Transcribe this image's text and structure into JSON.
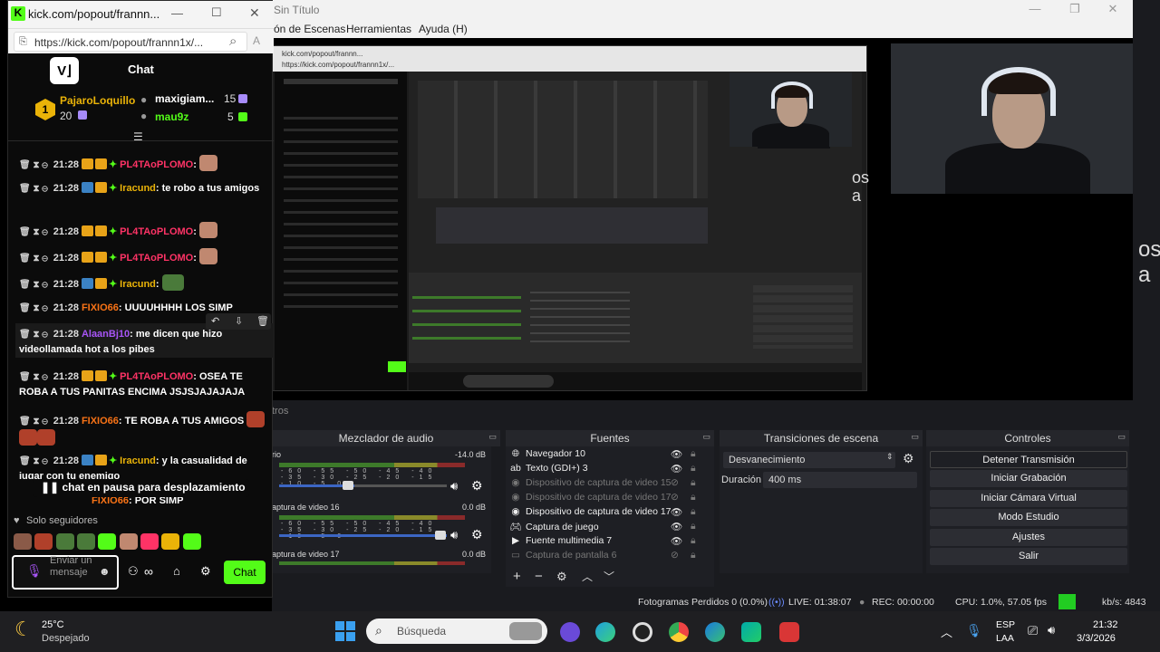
{
  "kick": {
    "window_title": "kick.com/popout/frannn...",
    "url": "https://kick.com/popout/frannn1x/...",
    "chat_label": "Chat",
    "top_gifters": [
      {
        "rank": "1",
        "name": "PajaroLoquillo",
        "count": "20"
      },
      {
        "name": "maxigiam...",
        "count": "15"
      },
      {
        "name": "mau9z",
        "count": "5"
      }
    ],
    "messages": [
      {
        "time": "21:28",
        "user": "PL4TAoPLOMO",
        "text": ""
      },
      {
        "time": "21:28",
        "user": "Iracund",
        "text": "te robo a tus amigos"
      },
      {
        "time": "21:28",
        "user": "PL4TAoPLOMO",
        "text": ""
      },
      {
        "time": "21:28",
        "user": "PL4TAoPLOMO",
        "text": ""
      },
      {
        "time": "21:28",
        "user": "Iracund",
        "text": ""
      },
      {
        "time": "21:28",
        "user": "FIXIO66",
        "text": "UUUUHHHH LOS SIMP"
      },
      {
        "time": "21:28",
        "user": "AlaanBj10",
        "text": "me dicen que hizo videollamada hot a los pibes"
      },
      {
        "time": "21:28",
        "user": "PL4TAoPLOMO",
        "text": "OSEA TE ROBA A TUS PANITAS ENCIMA JSJSJAJAJAJA"
      },
      {
        "time": "21:28",
        "user": "FIXIO66",
        "text": "TE ROBA A TUS AMIGOS"
      },
      {
        "time": "21:28",
        "user": "Iracund",
        "text": "y la casualidad de jugar con tu enemigo"
      },
      {
        "time": "",
        "user": "FIXIO66",
        "text": "POR SIMP"
      }
    ],
    "paused_banner": "chat en pausa para desplazamiento",
    "followers_only": "Solo seguidores",
    "input_placeholder": "Enviar un mensaje",
    "send_label": "Chat"
  },
  "obs": {
    "title": "Sin Título",
    "menu": [
      "ón de Escenas",
      "Herramientas",
      "Ayuda (H)"
    ],
    "side_text_1": "os\na",
    "side_text_2": "os\na",
    "filters_tab": "tros",
    "audio_mixer": {
      "header": "Mezclador de audio",
      "channels": [
        {
          "name": "rio",
          "db": "-14.0 dB"
        },
        {
          "name": "aptura de video 16",
          "db": "0.0 dB"
        },
        {
          "name": "aptura de video 17",
          "db": "0.0 dB"
        }
      ],
      "scale": "-60 -55 -50 -45 -40 -35 -30 -25 -20 -15 -10 -5 0"
    },
    "sources": {
      "header": "Fuentes",
      "items": [
        {
          "label": "Navegador 10",
          "enabled": true
        },
        {
          "label": "Texto (GDI+) 3",
          "enabled": true
        },
        {
          "label": "Dispositivo de captura de video 15",
          "enabled": false
        },
        {
          "label": "Dispositivo de captura de video 17",
          "enabled": false
        },
        {
          "label": "Dispositivo de captura de video 17",
          "enabled": true
        },
        {
          "label": "Captura de juego",
          "enabled": true
        },
        {
          "label": "Fuente multimedia 7",
          "enabled": true
        },
        {
          "label": "Captura de pantalla 6",
          "enabled": false
        }
      ]
    },
    "transitions": {
      "header": "Transiciones de escena",
      "selected": "Desvanecimiento",
      "duration_label": "Duración",
      "duration_value": "400 ms"
    },
    "controls": {
      "header": "Controles",
      "buttons": [
        "Detener Transmisión",
        "Iniciar Grabación",
        "Iniciar Cámara Virtual",
        "Modo Estudio",
        "Ajustes",
        "Salir"
      ]
    },
    "status": {
      "dropped": "Fotogramas Perdidos 0 (0.0%)",
      "live": "LIVE: 01:38:07",
      "rec": "REC: 00:00:00",
      "cpu": "CPU: 1.0%, 57.05 fps",
      "kbs": "kb/s: 4843",
      "live_color": "#22cc22"
    }
  },
  "taskbar": {
    "temp": "25°C",
    "weather": "Despejado",
    "search_placeholder": "Búsqueda",
    "lang_top": "ESP",
    "lang_bottom": "LAA",
    "time": "21:32",
    "date": "3/3/2026"
  },
  "colors": {
    "kick_green": "#53fc18",
    "obs_bg": "#1a1b1f"
  }
}
